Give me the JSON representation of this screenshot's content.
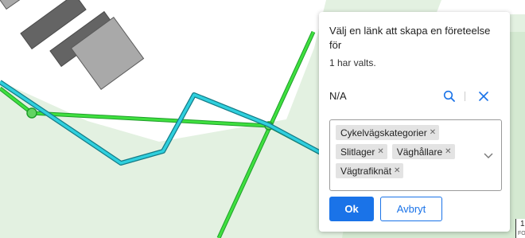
{
  "dialog": {
    "title": "Välj en länk att skapa en företeelse för",
    "selected_count_text": "1 har valts.",
    "selected_value": "N/A",
    "tags": [
      "Cykelvägskategorier",
      "Slitlager",
      "Väghållare",
      "Vägtrafiknät"
    ],
    "ok_label": "Ok",
    "cancel_label": "Avbryt"
  },
  "map": {
    "scale_main": "1",
    "scale_sub": "FO"
  },
  "colors": {
    "accent": "#1a73e8",
    "map_background": "#e0f0df",
    "building_fill": "#a9a9a9",
    "building_dark_fill": "#646464",
    "road_green": "#2ecc2e",
    "link_cyan": "#27c6d4"
  },
  "icons": {
    "search": "search-icon",
    "clear": "close-icon",
    "tag_remove": "close-icon",
    "dropdown": "chevron-down-icon"
  }
}
